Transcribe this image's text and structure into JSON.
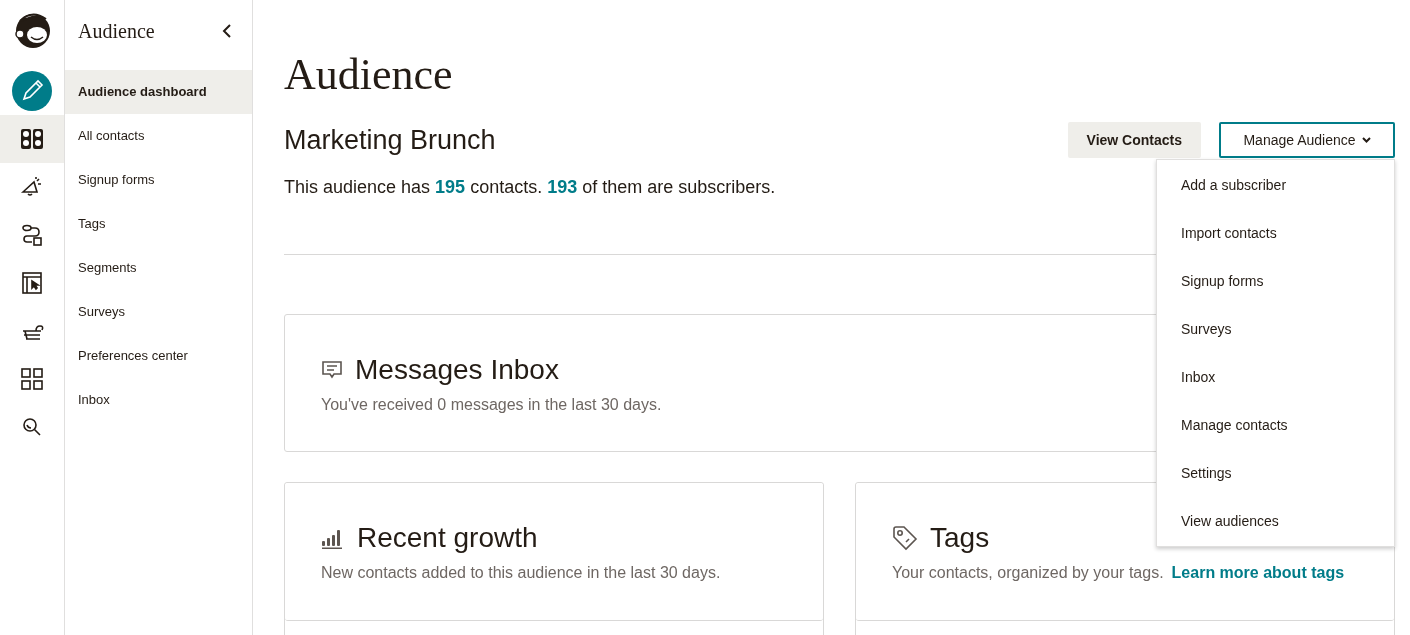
{
  "rail": [
    {
      "selected": false
    },
    {
      "selected": true
    },
    {
      "selected": false
    },
    {
      "selected": false
    },
    {
      "selected": false
    },
    {
      "selected": false
    },
    {
      "selected": false
    },
    {
      "selected": false
    }
  ],
  "sidebar": {
    "title": "Audience",
    "items": [
      {
        "label": "Audience dashboard",
        "selected": true
      },
      {
        "label": "All contacts",
        "selected": false
      },
      {
        "label": "Signup forms",
        "selected": false
      },
      {
        "label": "Tags",
        "selected": false
      },
      {
        "label": "Segments",
        "selected": false
      },
      {
        "label": "Surveys",
        "selected": false
      },
      {
        "label": "Preferences center",
        "selected": false
      },
      {
        "label": "Inbox",
        "selected": false
      }
    ]
  },
  "page": {
    "title": "Audience",
    "audience_name": "Marketing Brunch",
    "summary": "This audience has **195** contacts. **193** of them are subscribers.",
    "view_contacts": "View Contacts",
    "manage_audience": {
      "label": "Manage Audience",
      "expanded": true,
      "menu": [
        "Add a subscriber",
        "Import contacts",
        "Signup forms",
        "Surveys",
        "Inbox",
        "Manage contacts",
        "Settings",
        "View audiences"
      ]
    }
  },
  "cards": [
    {
      "title": "Messages Inbox",
      "description": "You've received 0 messages in the last 30 days."
    },
    {
      "title": "Recent growth",
      "description": "New contacts added to this audience in the last 30 days."
    },
    {
      "title": "Tags",
      "description": "Your contacts, organized by your tags.",
      "link": "Learn more about tags"
    }
  ]
}
